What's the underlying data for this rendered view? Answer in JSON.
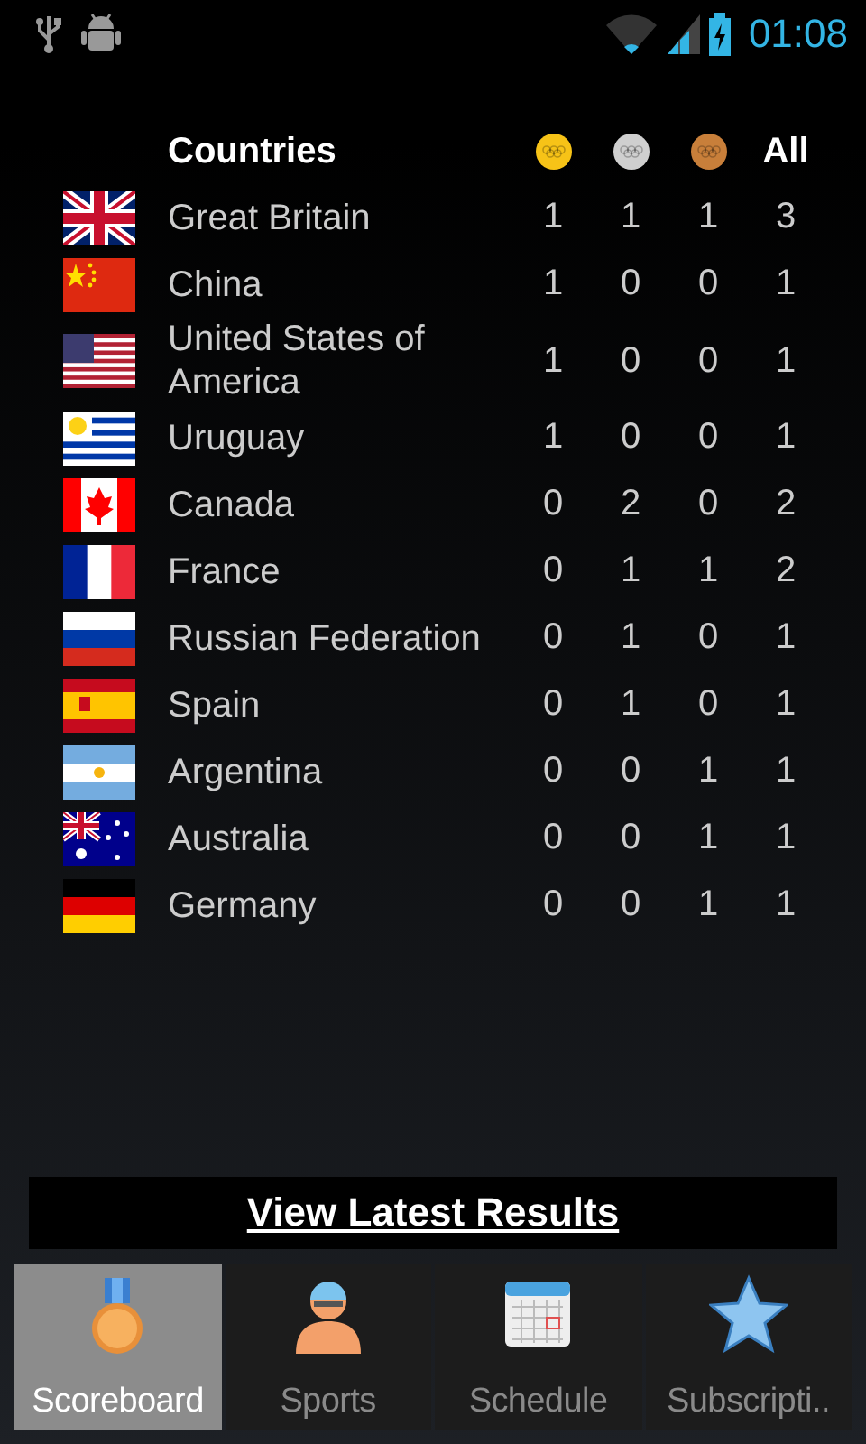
{
  "status_bar": {
    "time": "01:08"
  },
  "table": {
    "columns": [
      "Countries",
      "All"
    ],
    "rows": [
      {
        "country": "Great Britain",
        "gold": "1",
        "silver": "1",
        "bronze": "1",
        "all": "3"
      },
      {
        "country": "China",
        "gold": "1",
        "silver": "0",
        "bronze": "0",
        "all": "1"
      },
      {
        "country": "United States of America",
        "gold": "1",
        "silver": "0",
        "bronze": "0",
        "all": "1"
      },
      {
        "country": "Uruguay",
        "gold": "1",
        "silver": "0",
        "bronze": "0",
        "all": "1"
      },
      {
        "country": "Canada",
        "gold": "0",
        "silver": "2",
        "bronze": "0",
        "all": "2"
      },
      {
        "country": "France",
        "gold": "0",
        "silver": "1",
        "bronze": "1",
        "all": "2"
      },
      {
        "country": "Russian Federation",
        "gold": "0",
        "silver": "1",
        "bronze": "0",
        "all": "1"
      },
      {
        "country": "Spain",
        "gold": "0",
        "silver": "1",
        "bronze": "0",
        "all": "1"
      },
      {
        "country": "Argentina",
        "gold": "0",
        "silver": "0",
        "bronze": "1",
        "all": "1"
      },
      {
        "country": "Australia",
        "gold": "0",
        "silver": "0",
        "bronze": "1",
        "all": "1"
      },
      {
        "country": "Germany",
        "gold": "0",
        "silver": "0",
        "bronze": "1",
        "all": "1"
      }
    ]
  },
  "link": "View Latest Results",
  "tabs": [
    {
      "label": "Scoreboard",
      "selected": true
    },
    {
      "label": "Sports",
      "selected": false
    },
    {
      "label": "Schedule",
      "selected": false
    },
    {
      "label": "Subscripti..",
      "selected": false
    }
  ]
}
